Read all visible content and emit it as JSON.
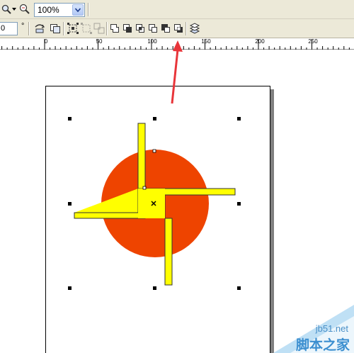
{
  "toolbar": {
    "zoom_value": "100%",
    "rotation_value": "0",
    "degree_symbol": "°"
  },
  "ruler": {
    "labels": [
      "0",
      "50",
      "100",
      "150",
      "200",
      "250"
    ]
  },
  "icons": [
    "zoom-tool-icon",
    "dropdown-arrow-icon",
    "zoom-level-icon",
    "mirror-horizontal-icon",
    "mirror-vertical-icon",
    "align-distribute-icon",
    "group-icon",
    "ungroup-icon",
    "combine-icon",
    "break-apart-icon",
    "weld-icon",
    "trim-icon",
    "intersect-icon",
    "simplify-icon",
    "front-minus-back-icon",
    "back-minus-front-icon",
    "to-curves-icon"
  ],
  "colors": {
    "circle": "#ee4400",
    "pinwheel": "#ffff00",
    "arrow": "#e8353a",
    "toolbar": "#ece9d8",
    "canvas": "#ffffff"
  },
  "watermark": {
    "site": "jb51.net",
    "title": "脚本之家"
  }
}
